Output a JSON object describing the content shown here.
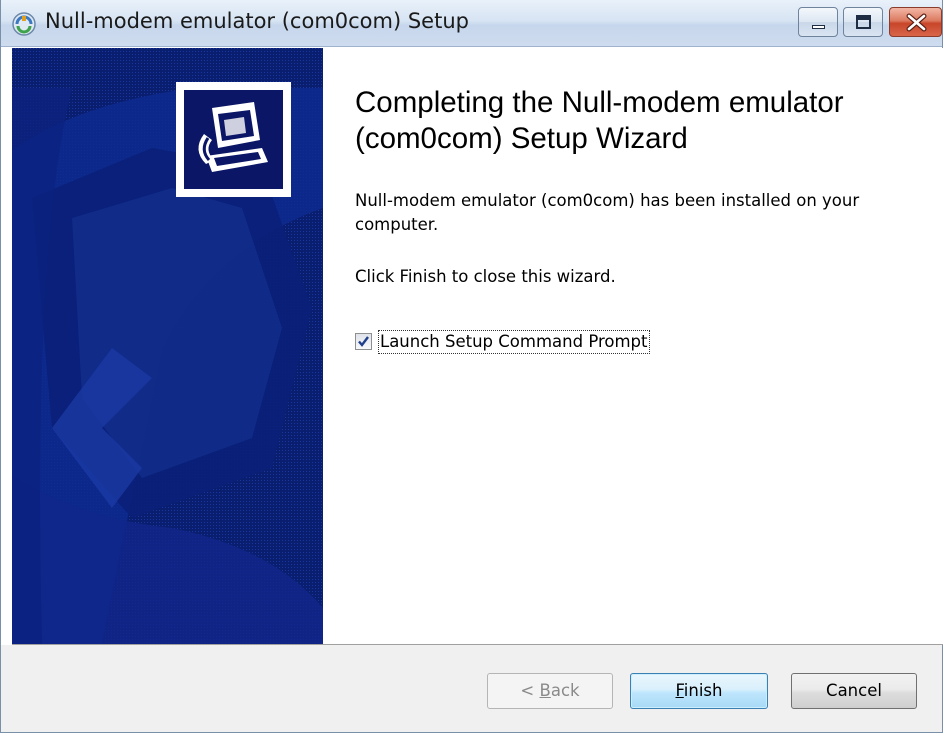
{
  "window": {
    "title": "Null-modem emulator (com0com) Setup"
  },
  "titlebar_buttons": {
    "minimize_icon": "minimize-icon",
    "maximize_icon": "maximize-icon",
    "close_icon": "close-icon"
  },
  "content": {
    "heading": "Completing the Null-modem emulator (com0com) Setup Wizard",
    "paragraph1": "Null-modem emulator (com0com) has been installed on your computer.",
    "paragraph2": "Click Finish to close this wizard.",
    "checkbox": {
      "label": "Launch Setup Command Prompt",
      "checked": true
    }
  },
  "buttons": {
    "back_prefix": "< ",
    "back_key": "B",
    "back_rest": "ack",
    "back_enabled": false,
    "finish_key": "F",
    "finish_rest": "inish",
    "cancel": "Cancel"
  },
  "colors": {
    "sidebar_bg": "#0a1e70",
    "finish_border": "#3c7fb1"
  }
}
